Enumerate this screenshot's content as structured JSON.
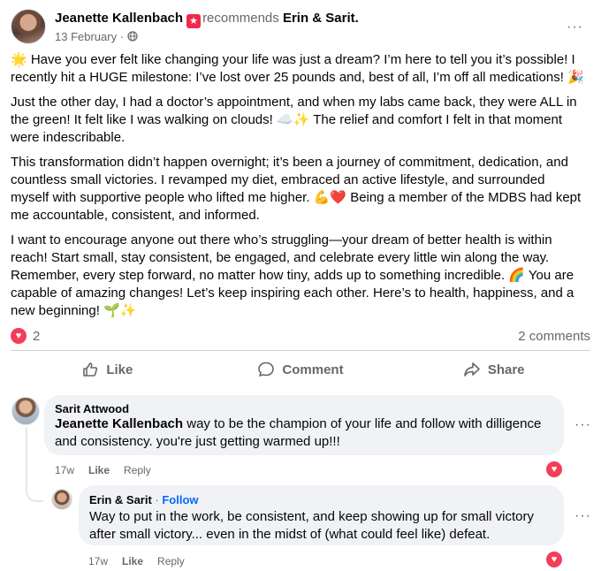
{
  "post": {
    "author": "Jeanette Kallenbach",
    "recommend_word": "recommends",
    "target": "Erin & Sarit.",
    "date": "13 February",
    "date_sep": "·",
    "more_label": "···",
    "paragraphs": [
      "🌟 Have you ever felt like changing your life was just a dream? I’m here to tell you it’s possible! I recently hit a HUGE milestone: I’ve lost over 25 pounds and, best of all, I’m off all medications! 🎉",
      "Just the other day, I had a doctor’s appointment, and when my labs came back, they were ALL in the green! It felt like I was walking on clouds! ☁️✨ The relief and comfort I felt in that moment were indescribable.",
      "This transformation didn’t happen overnight; it’s been a journey of commitment, dedication, and countless small victories. I revamped my diet, embraced an active lifestyle, and surrounded myself with supportive people who lifted me higher. 💪❤️ Being a member of the MDBS had kept me accountable, consistent, and informed.",
      "I want to encourage anyone out there who’s struggling—your dream of better health is within reach! Start small, stay consistent, be engaged,  and celebrate every little win along the way. Remember, every step forward, no matter how tiny, adds up to something incredible. 🌈 You are capable of amazing changes! Let’s keep inspiring each other. Here’s to health, happiness, and a new beginning! 🌱✨"
    ],
    "reaction_count": "2",
    "comment_count": "2 comments"
  },
  "actions": {
    "like": "Like",
    "comment": "Comment",
    "share": "Share"
  },
  "comments": [
    {
      "author": "Sarit Attwood",
      "mention": "Jeanette Kallenbach",
      "text": " way to be the champion of your life and follow with dilligence and consistency. you're just getting warmed up!!!",
      "time": "17w",
      "like": "Like",
      "reply": "Reply",
      "more": "···"
    },
    {
      "author": "Erin & Sarit",
      "sep": " · ",
      "follow": "Follow",
      "text": "Way to put in the work, be consistent, and keep showing up for small victory after small victory... even in the midst of (what could feel like) defeat.",
      "time": "17w",
      "like": "Like",
      "reply": "Reply",
      "more": "···"
    }
  ],
  "icons": {
    "badge": "recommend-star-icon",
    "globe": "globe-icon",
    "heart": "heart-icon",
    "like": "thumbs-up-icon",
    "comment": "comment-bubble-icon",
    "share": "share-arrow-icon"
  },
  "colors": {
    "heart": "#f33e58",
    "badge": "#f02849",
    "follow": "#0866ff",
    "bubble": "#f0f2f5",
    "meta": "#65676b"
  }
}
